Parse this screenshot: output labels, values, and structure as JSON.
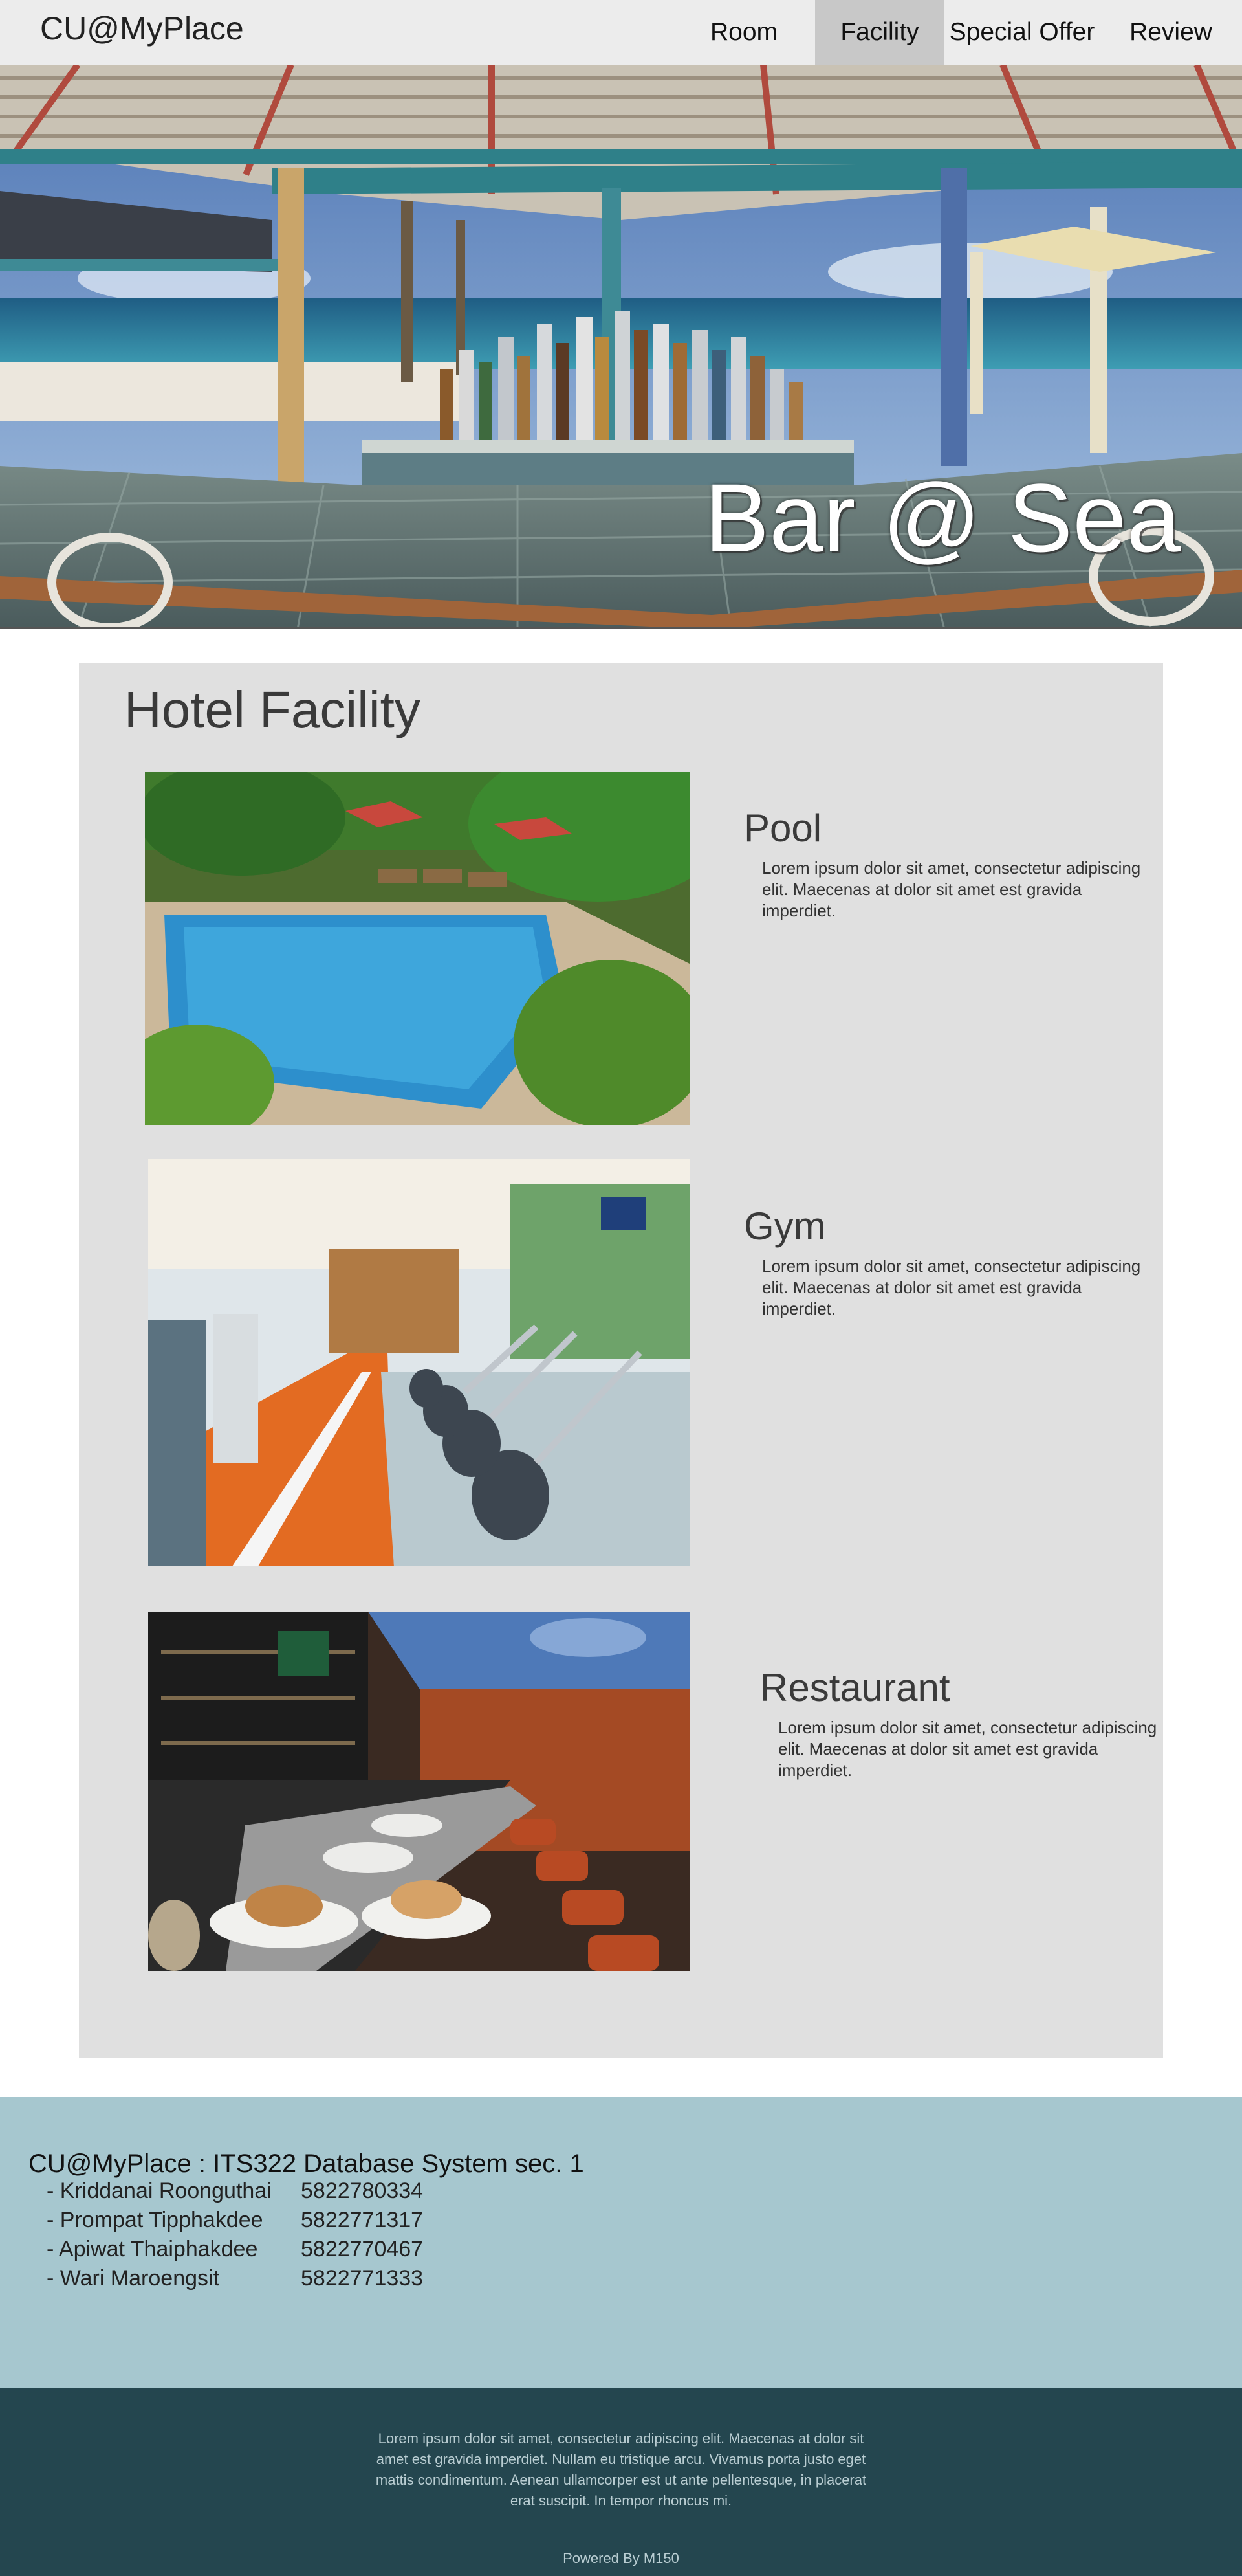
{
  "navbar": {
    "brand": "CU@MyPlace",
    "items": [
      {
        "label": "Room"
      },
      {
        "label": "Facility"
      },
      {
        "label": "Special Offer"
      },
      {
        "label": "Review"
      }
    ]
  },
  "hero": {
    "title": "Bar @ Sea"
  },
  "facility_section": {
    "title": "Hotel Facility",
    "items": [
      {
        "name": "Pool",
        "description": "Lorem ipsum dolor sit amet, consectetur adipiscing elit. Maecenas at dolor sit amet est gravida imperdiet."
      },
      {
        "name": "Gym",
        "description": "Lorem ipsum dolor sit amet, consectetur adipiscing elit. Maecenas at dolor sit amet est gravida imperdiet."
      },
      {
        "name": "Restaurant",
        "description": "Lorem ipsum dolor sit amet, consectetur adipiscing elit. Maecenas at dolor sit amet est gravida imperdiet."
      }
    ]
  },
  "footer": {
    "title": "CU@MyPlace : ITS322 Database System sec. 1",
    "members": [
      {
        "name": "- Kriddanai Roonguthai",
        "id": "5822780334"
      },
      {
        "name": "- Prompat Tipphakdee",
        "id": "5822771317"
      },
      {
        "name": "- Apiwat Thaiphakdee",
        "id": "5822770467"
      },
      {
        "name": "- Wari Maroengsit",
        "id": "5822771333"
      }
    ],
    "text": "Lorem ipsum dolor sit amet, consectetur adipiscing elit. Maecenas at dolor sit amet est gravida imperdiet. Nullam eu tristique arcu. Vivamus porta justo eget mattis condimentum. Aenean ullamcorper est ut ante pellentesque, in placerat erat suscipit. In tempor rhoncus mi.",
    "powered": "Powered By M150"
  },
  "colors": {
    "navbar_bg": "#ececec",
    "nav_active_bg": "#c8c8c8",
    "panel_bg": "#e0e0e0",
    "footer_info_bg": "#a6c7cf",
    "footer_dark_bg": "#24464f"
  }
}
